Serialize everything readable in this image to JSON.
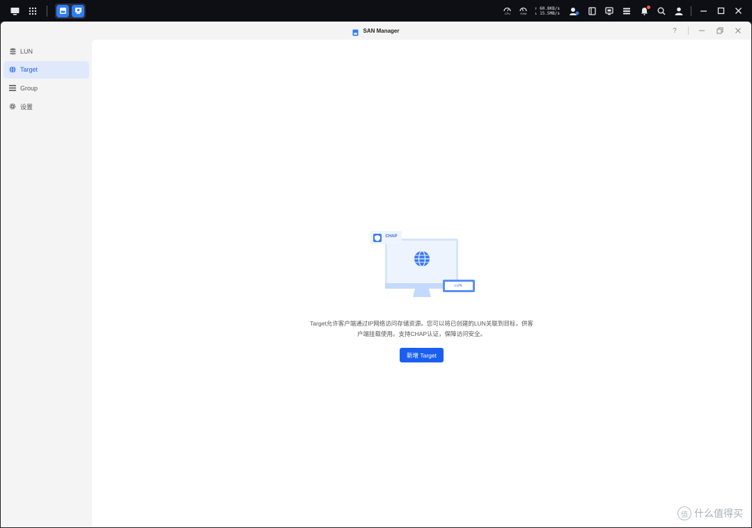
{
  "system_bar": {
    "cpu_label": "CPU",
    "ram_label": "RAM",
    "upload": "↑ 60.8KB/s",
    "download": "↓ 15.5MB/s"
  },
  "window": {
    "title": "SAN Manager",
    "help": "?"
  },
  "sidebar": {
    "items": [
      {
        "label": "LUN",
        "icon": "database-icon"
      },
      {
        "label": "Target",
        "icon": "globe-icon"
      },
      {
        "label": "Group",
        "icon": "list-icon"
      },
      {
        "label": "设置",
        "icon": "gear-icon"
      }
    ],
    "active": "Target"
  },
  "empty_state": {
    "chap_tag": "CHAP",
    "lun_tag": "LUN",
    "description": "Target允许客户端通过IP网络访问存储资源。您可以将已创建的LUN关联到目标，供客户端挂载使用。支持CHAP认证，保障访问安全。",
    "button": "新增 Target"
  },
  "watermark": "什么值得买",
  "colors": {
    "accent": "#1b5ff0",
    "active_bg": "#dfe9fb",
    "sysbar_bg": "#0d0f14",
    "notification": "#ff5a3c"
  }
}
